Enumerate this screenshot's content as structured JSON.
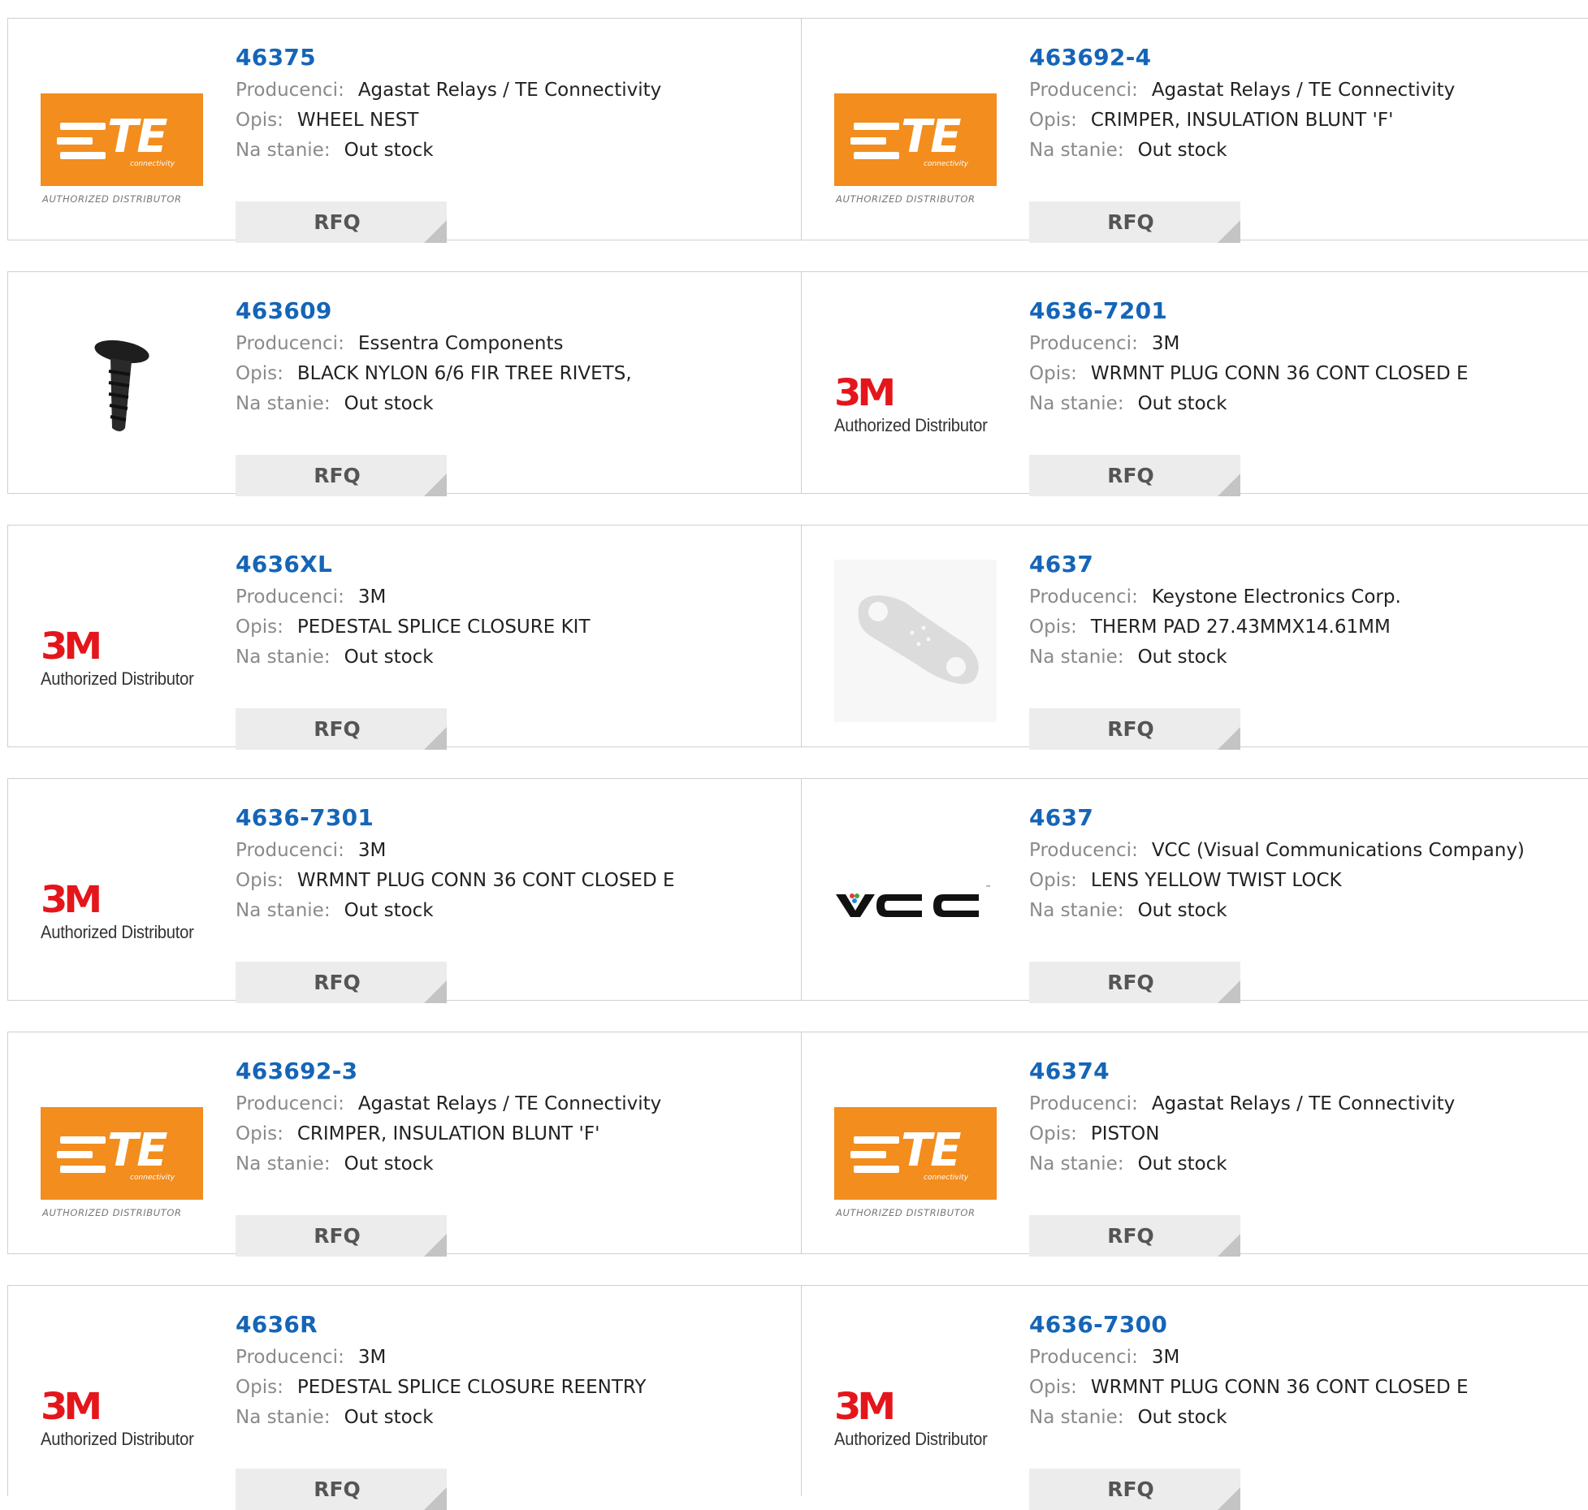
{
  "labels": {
    "manufacturer": "Producenci:",
    "description": "Opis:",
    "stock": "Na stanie:",
    "rfq": "RFQ"
  },
  "logo_text": {
    "te_letters": "TE",
    "te_sub": "connectivity",
    "te_authorized": "AUTHORIZED DISTRIBUTOR",
    "m3": "3M",
    "m3_authorized": "Authorized Distributor",
    "vcc": "VCC"
  },
  "colors": {
    "part_number": "#1565b7",
    "te_orange": "#f28d1e",
    "m3_red": "#e4161b",
    "rfq_bg": "#ececec",
    "border": "#cfcfcf"
  },
  "products": [
    {
      "part": "46375",
      "manufacturer": "Agastat Relays / TE Connectivity",
      "description": "WHEEL NEST",
      "stock": "Out stock",
      "logo": "te-logo"
    },
    {
      "part": "463692-4",
      "manufacturer": "Agastat Relays / TE Connectivity",
      "description": "CRIMPER, INSULATION BLUNT 'F'",
      "stock": "Out stock",
      "logo": "te-logo"
    },
    {
      "part": "463609",
      "manufacturer": "Essentra Components",
      "description": "BLACK NYLON 6/6 FIR TREE RIVETS,",
      "stock": "Out stock",
      "logo": "rivet-image"
    },
    {
      "part": "4636-7201",
      "manufacturer": "3M",
      "description": "WRMNT PLUG CONN 36 CONT CLOSED E",
      "stock": "Out stock",
      "logo": "3m-logo"
    },
    {
      "part": "4636XL",
      "manufacturer": "3M",
      "description": "PEDESTAL SPLICE CLOSURE KIT",
      "stock": "Out stock",
      "logo": "3m-logo"
    },
    {
      "part": "4637",
      "manufacturer": "Keystone Electronics Corp.",
      "description": "THERM PAD 27.43MMX14.61MM",
      "stock": "Out stock",
      "logo": "thermal-pad-image"
    },
    {
      "part": "4636-7301",
      "manufacturer": "3M",
      "description": "WRMNT PLUG CONN 36 CONT CLOSED E",
      "stock": "Out stock",
      "logo": "3m-logo"
    },
    {
      "part": "4637",
      "manufacturer": "VCC (Visual Communications Company)",
      "description": "LENS YELLOW TWIST LOCK",
      "stock": "Out stock",
      "logo": "vcc-logo"
    },
    {
      "part": "463692-3",
      "manufacturer": "Agastat Relays / TE Connectivity",
      "description": "CRIMPER, INSULATION BLUNT 'F'",
      "stock": "Out stock",
      "logo": "te-logo"
    },
    {
      "part": "46374",
      "manufacturer": "Agastat Relays / TE Connectivity",
      "description": "PISTON",
      "stock": "Out stock",
      "logo": "te-logo"
    },
    {
      "part": "4636R",
      "manufacturer": "3M",
      "description": "PEDESTAL SPLICE CLOSURE REENTRY",
      "stock": "Out stock",
      "logo": "3m-logo"
    },
    {
      "part": "4636-7300",
      "manufacturer": "3M",
      "description": "WRMNT PLUG CONN 36 CONT CLOSED E",
      "stock": "Out stock",
      "logo": "3m-logo"
    }
  ]
}
